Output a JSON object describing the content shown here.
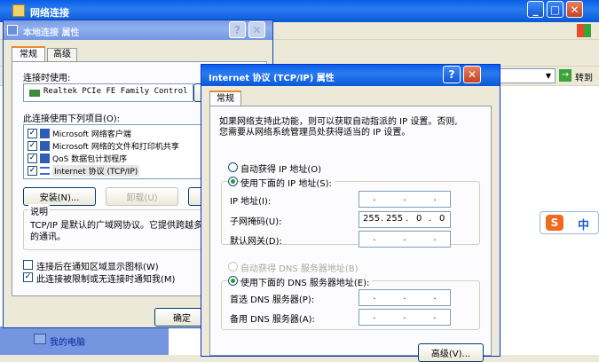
{
  "bg_window": {
    "title": "网络连接",
    "address_go": "转到",
    "sidebar_my_computer": "我的电脑"
  },
  "ime": {
    "label": "中"
  },
  "local_props": {
    "title": "本地连接 属性",
    "tabs": [
      "常规",
      "高级"
    ],
    "connect_using_label": "连接时使用:",
    "adapter": "Realtek PCIe FE Family Control",
    "items_label": "此连接使用下列项目(O):",
    "items": [
      {
        "label": "Microsoft 网络客户端",
        "checked": true
      },
      {
        "label": "Microsoft 网络的文件和打印机共享",
        "checked": true
      },
      {
        "label": "QoS 数据包计划程序",
        "checked": true
      },
      {
        "label": "Internet 协议 (TCP/IP)",
        "checked": true
      }
    ],
    "install_btn": "安装(N)...",
    "uninstall_btn": "卸载(U)",
    "desc_title": "说明",
    "desc_text1": "TCP/IP 是默认的广域网协议。它提供跨越多",
    "desc_text2": "的通讯。",
    "notify_label": "连接后在通知区域显示图标(W)",
    "limited_label": "此连接被限制或无连接时通知我(M)",
    "ok_btn": "确定"
  },
  "tcpip": {
    "title": "Internet 协议 (TCP/IP) 属性",
    "tab": "常规",
    "info1": "如果网络支持此功能，则可以获取自动指派的 IP 设置。否则,",
    "info2": "您需要从网络系统管理员处获得适当的 IP 设置。",
    "auto_ip": "自动获得 IP 地址(O)",
    "manual_ip": "使用下面的 IP 地址(S):",
    "ip_label": "IP 地址(I):",
    "mask_label": "子网掩码(U):",
    "gateway_label": "默认网关(D):",
    "mask_value": [
      "255",
      "255",
      "0",
      "0"
    ],
    "auto_dns": "自动获得 DNS 服务器地址(B)",
    "manual_dns": "使用下面的 DNS 服务器地址(E):",
    "dns1_label": "首选 DNS 服务器(P):",
    "dns2_label": "备用 DNS 服务器(A):",
    "advanced_btn": "高级(V)..."
  }
}
